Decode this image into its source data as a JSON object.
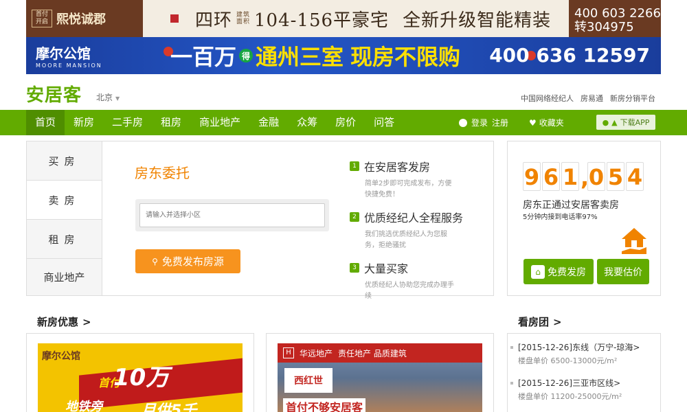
{
  "banner1": {
    "left_small": "首付开启",
    "left_brand": "熙悦诚郡",
    "headline_a": "四环",
    "headline_stack": "建筑面积",
    "headline_b": "104-156平豪宅",
    "headline_c": "全新升级智能精装",
    "phone_1": "400 603 2266",
    "phone_2": "转304975"
  },
  "banner2": {
    "brand": "摩尔公馆",
    "brand_en": "MOORE MANSION",
    "slogan_a": "一百万",
    "slogan_circle": "得",
    "slogan_b": "通州三室",
    "slogan_c": "现房不限购",
    "phone": "400 636 12597"
  },
  "header": {
    "logo": "安居客",
    "city": "北京",
    "top_links": [
      "中国网络经纪人",
      "房易通",
      "新房分销平台"
    ]
  },
  "nav": {
    "items": [
      "首页",
      "新房",
      "二手房",
      "租房",
      "商业地产",
      "金融",
      "众筹",
      "房价",
      "问答"
    ],
    "login": "登录",
    "register": "注册",
    "favorites": "收藏夹",
    "app": "下载APP"
  },
  "panel": {
    "tabs": [
      "买房",
      "卖房",
      "租房",
      "商业地产"
    ],
    "title": "房东委托",
    "input_placeholder": "请输入并选择小区",
    "button": "免费发布房源",
    "steps": [
      {
        "num": "1",
        "title": "在安居客发房",
        "desc": "简单2步即可完成发布，方便快捷免费！"
      },
      {
        "num": "2",
        "title": "优质经纪人全程服务",
        "desc": "我们挑选优质经纪人为您服务，拒绝骚扰"
      },
      {
        "num": "3",
        "title": "大量买家",
        "desc": "优质经纪人协助您完成办理手续"
      }
    ]
  },
  "stats": {
    "digits": [
      "9",
      "6",
      "1",
      "0",
      "5",
      "4"
    ],
    "line1": "房东正通过安居客卖房",
    "line2": "5分钟内接到电话率97%",
    "btn_publish": "免费发房",
    "btn_estimate": "我要估价"
  },
  "sections": {
    "new_house": "新房优惠",
    "tour": "看房团",
    "arrow": ">"
  },
  "ads": {
    "ad1_logo": "摩尔公馆",
    "ad1_big": "10万",
    "ad1_small": "首付",
    "ad1_sub": "地铁旁",
    "ad1_sub2": "月供5千",
    "ad2_brand": "华远地产",
    "ad2_slogan": "责任地产 品质建筑",
    "ad2_tag": "西红世",
    "ad2_bottom": "首付不够安居客"
  },
  "tours": [
    {
      "title": "[2015-12-26]东线（万宁-琼海>",
      "price": "楼盘单价 6500-13000元/m²"
    },
    {
      "title": "[2015-12-26]三亚市区线>",
      "price": "楼盘单价 11200-25000元/m²"
    }
  ],
  "colors": {
    "brand_green": "#62ab00",
    "accent_orange": "#f08300",
    "button_orange": "#f7931e"
  }
}
